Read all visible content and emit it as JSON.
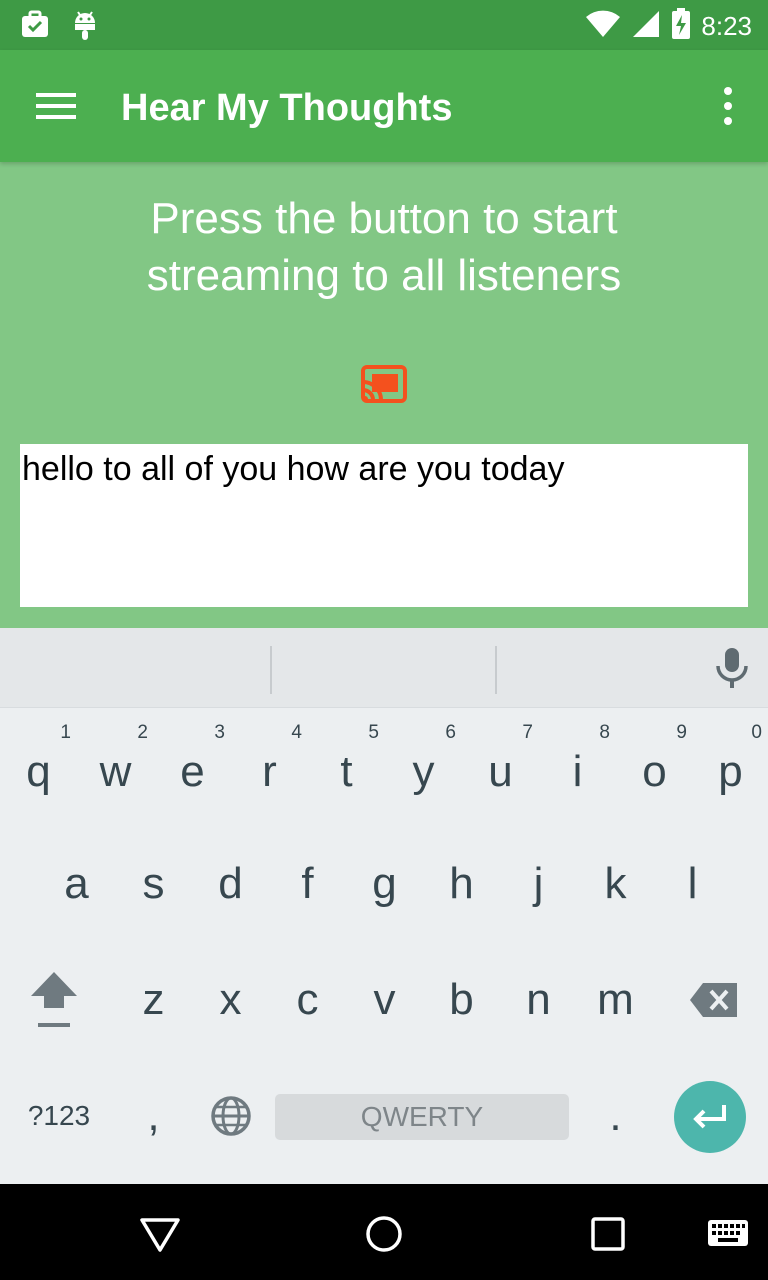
{
  "status_bar": {
    "time": "8:23"
  },
  "app_bar": {
    "title": "Hear My Thoughts"
  },
  "main": {
    "headline_line1": "Press the button to start",
    "headline_line2": "streaming to all listeners",
    "message_text": "hello to all of you how are you today"
  },
  "keyboard": {
    "row1": [
      {
        "key": "q",
        "hint": "1"
      },
      {
        "key": "w",
        "hint": "2"
      },
      {
        "key": "e",
        "hint": "3"
      },
      {
        "key": "r",
        "hint": "4"
      },
      {
        "key": "t",
        "hint": "5"
      },
      {
        "key": "y",
        "hint": "6"
      },
      {
        "key": "u",
        "hint": "7"
      },
      {
        "key": "i",
        "hint": "8"
      },
      {
        "key": "o",
        "hint": "9"
      },
      {
        "key": "p",
        "hint": "0"
      }
    ],
    "row2": [
      "a",
      "s",
      "d",
      "f",
      "g",
      "h",
      "j",
      "k",
      "l"
    ],
    "row3": [
      "z",
      "x",
      "c",
      "v",
      "b",
      "n",
      "m"
    ],
    "symbols_label": "?123",
    "comma_label": ",",
    "space_label": "QWERTY",
    "period_label": "."
  },
  "colors": {
    "status_bar": "#3e9a45",
    "app_bar": "#4caf50",
    "background": "#82c785",
    "cast_icon": "#f4511e",
    "enter_key": "#4db6ac"
  },
  "icons": [
    "briefcase-check-icon",
    "android-icon",
    "wifi-icon",
    "signal-icon",
    "battery-charging-icon",
    "hamburger-menu-icon",
    "more-vert-icon",
    "cast-connected-icon",
    "microphone-icon",
    "shift-icon",
    "backspace-icon",
    "globe-icon",
    "enter-icon",
    "back-icon",
    "home-icon",
    "recents-icon",
    "keyboard-icon"
  ]
}
